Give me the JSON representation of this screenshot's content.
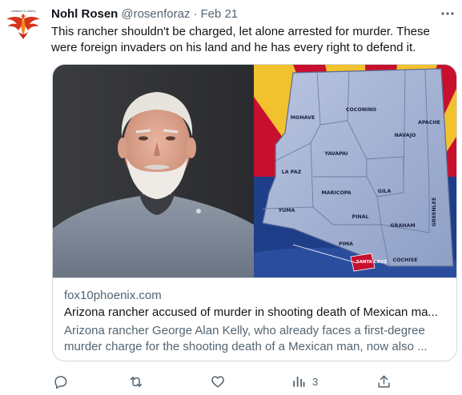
{
  "tweet": {
    "display_name": "Nohl Rosen",
    "handle": "@rosenforaz",
    "separator": "·",
    "date": "Feb 21",
    "text": "This rancher shouldn't be charged, let alone arrested for murder. These were foreign invaders on his land and he has every right to defend it."
  },
  "avatar": {
    "icon": "phoenix-logo-icon",
    "logo_text": "Freedom & Liberty"
  },
  "card": {
    "domain": "fox10phoenix.com",
    "title": "Arizona rancher accused of murder in shooting death of Mexican ma...",
    "description": "Arizona rancher George Alan Kelly, who already faces a first-degree murder charge for the shooting death of a Mexican man, now also ...",
    "map_counties": [
      "COCONINO",
      "MOHAVE",
      "APACHE",
      "NAVAJO",
      "YAVAPAI",
      "LA PAZ",
      "MARICOPA",
      "GILA",
      "YUMA",
      "PINAL",
      "GRAHAM",
      "GREENLEE",
      "PIMA",
      "SANTA CRUZ",
      "COCHISE"
    ]
  },
  "actions": {
    "reply_icon": "reply-icon",
    "retweet_icon": "retweet-icon",
    "like_icon": "like-icon",
    "views_icon": "views-icon",
    "views_count": "3",
    "share_icon": "share-icon"
  },
  "colors": {
    "text": "#0f1419",
    "secondary": "#536471",
    "border": "#cfd9de",
    "flag_red": "#c8102e",
    "flag_blue": "#1f3e8a",
    "flag_yellow": "#f2c12e",
    "map_fill": "#a9b7d6"
  }
}
